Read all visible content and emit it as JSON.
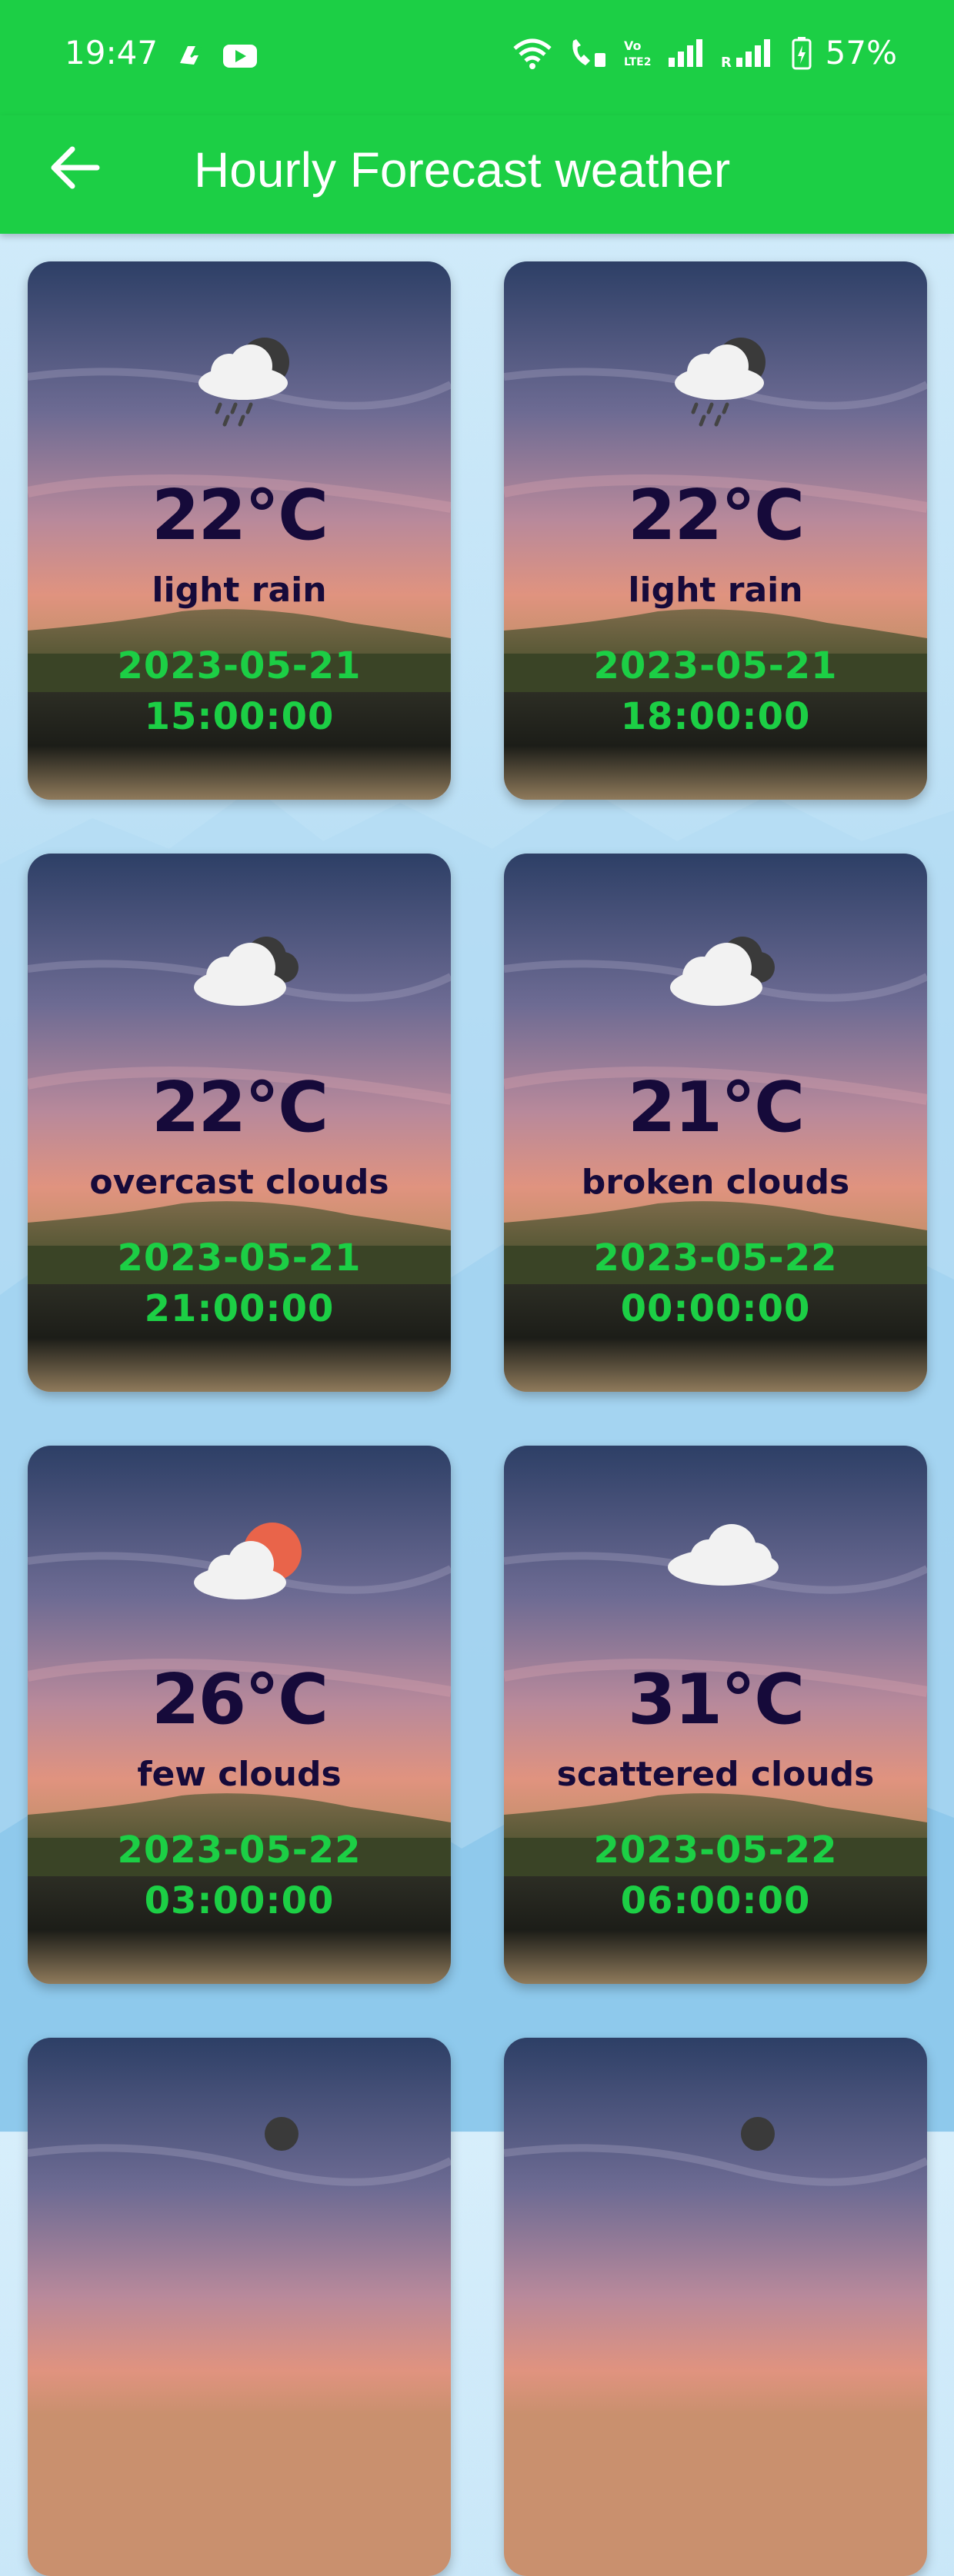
{
  "status_bar": {
    "time": "19:47",
    "battery": "57%"
  },
  "app_bar": {
    "title": "Hourly Forecast weather"
  },
  "forecasts": [
    {
      "temp": "22°C",
      "description": "light rain",
      "date": "2023-05-21",
      "time": "15:00:00",
      "icon": "rain-cloud-icon"
    },
    {
      "temp": "22°C",
      "description": "light rain",
      "date": "2023-05-21",
      "time": "18:00:00",
      "icon": "rain-cloud-icon"
    },
    {
      "temp": "22°C",
      "description": "overcast clouds",
      "date": "2023-05-21",
      "time": "21:00:00",
      "icon": "overcast-clouds-icon"
    },
    {
      "temp": "21°C",
      "description": "broken clouds",
      "date": "2023-05-22",
      "time": "00:00:00",
      "icon": "broken-clouds-icon"
    },
    {
      "temp": "26°C",
      "description": "few clouds",
      "date": "2023-05-22",
      "time": "03:00:00",
      "icon": "sun-cloud-icon"
    },
    {
      "temp": "31°C",
      "description": "scattered clouds",
      "date": "2023-05-22",
      "time": "06:00:00",
      "icon": "cloud-icon"
    }
  ]
}
